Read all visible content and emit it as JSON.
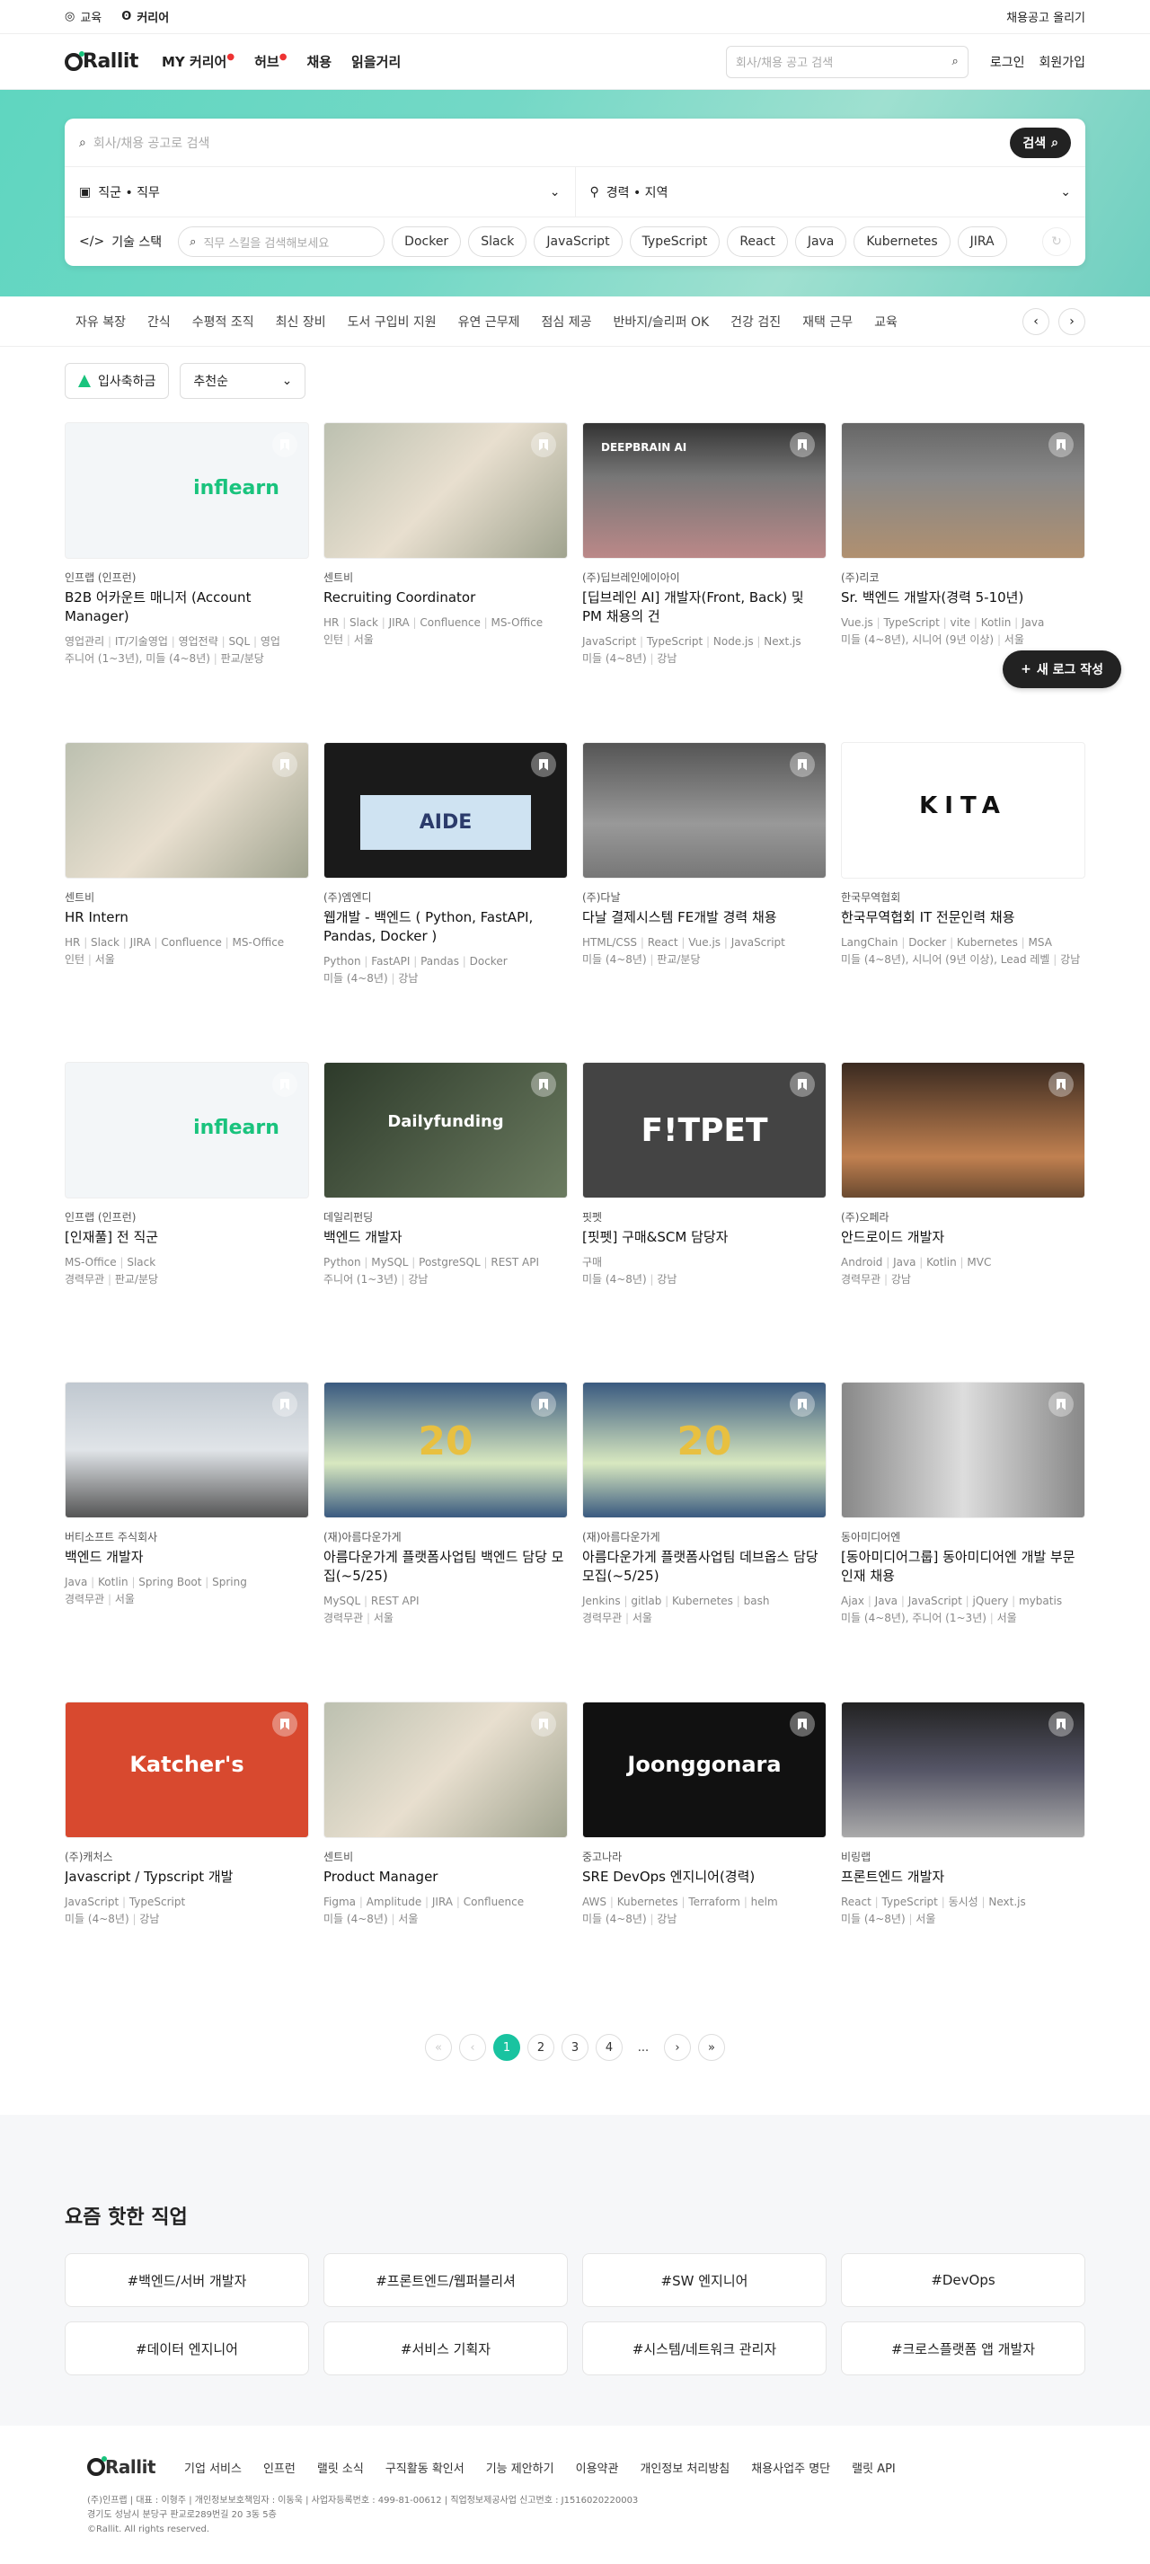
{
  "topbar": {
    "items": [
      "교육",
      "커리어"
    ],
    "post_job": "채용공고 올리기"
  },
  "header": {
    "logo": "Rallit",
    "nav": [
      "MY 커리어",
      "허브",
      "채용",
      "읽을거리"
    ],
    "search_placeholder": "회사/채용 공고 검색",
    "login": "로그인",
    "signup": "회원가입"
  },
  "hero": {
    "search_placeholder": "회사/채용 공고로 검색",
    "search_button": "검색",
    "job_select": "직군 • 직무",
    "loc_select": "경력 • 지역",
    "skill_label": "기술 스택",
    "skill_placeholder": "직무 스킬을 검색해보세요",
    "chips": [
      "Docker",
      "Slack",
      "JavaScript",
      "TypeScript",
      "React",
      "Java",
      "Kubernetes",
      "JIRA"
    ]
  },
  "tags": [
    "자유 복장",
    "간식",
    "수평적 조직",
    "최신 장비",
    "도서 구입비 지원",
    "유연 근무제",
    "점심 제공",
    "반바지/슬리퍼 OK",
    "건강 검진",
    "재택 근무",
    "교육"
  ],
  "filters": {
    "bonus": "입사축하금",
    "sort": "추천순"
  },
  "new_log": "새 로그 작성",
  "cards": [
    {
      "company": "인프랩 (인프런)",
      "title": "B2B 어카운트 매니저 (Account Manager)",
      "skills": [
        "영업관리",
        "IT/기술영업",
        "영업전략",
        "SQL",
        "영업"
      ],
      "info": [
        "주니어 (1~3년), 미들 (4~8년)",
        "판교/분당"
      ],
      "thumb": "inflearn",
      "logo_text": "inflearn"
    },
    {
      "company": "센트비",
      "title": "Recruiting Coordinator",
      "skills": [
        "HR",
        "Slack",
        "JIRA",
        "Confluence",
        "MS-Office"
      ],
      "info": [
        "인턴",
        "서울"
      ],
      "thumb": "phone",
      "logo_text": ""
    },
    {
      "company": "(주)딥브레인에이아이",
      "title": "[딥브레인 AI] 개발자(Front, Back) 및 PM 채용의 건",
      "skills": [
        "JavaScript",
        "TypeScript",
        "Node.js",
        "Next.js"
      ],
      "info": [
        "미들 (4~8년)",
        "강남"
      ],
      "thumb": "office",
      "logo_text": "DEEPBRAIN AI"
    },
    {
      "company": "(주)리코",
      "title": "Sr. 백엔드 개발자(경력 5-10년)",
      "skills": [
        "Vue.js",
        "TypeScript",
        "vite",
        "Kotlin",
        "Java"
      ],
      "info": [
        "미들 (4~8년), 시니어 (9년 이상)",
        "서울"
      ],
      "thumb": "crowd",
      "logo_text": ""
    },
    {
      "company": "센트비",
      "title": "HR Intern",
      "skills": [
        "HR",
        "Slack",
        "JIRA",
        "Confluence",
        "MS-Office"
      ],
      "info": [
        "인턴",
        "서울"
      ],
      "thumb": "phone",
      "logo_text": ""
    },
    {
      "company": "(주)엠엔디",
      "title": "웹개발 - 백엔드 ( Python, FastAPI, Pandas, Docker )",
      "skills": [
        "Python",
        "FastAPI",
        "Pandas",
        "Docker"
      ],
      "info": [
        "미들 (4~8년)",
        "강남"
      ],
      "thumb": "aide",
      "logo_text": "AIDE"
    },
    {
      "company": "(주)다날",
      "title": "다날 결제시스템 FE개발 경력 채용",
      "skills": [
        "HTML/CSS",
        "React",
        "Vue.js",
        "JavaScript"
      ],
      "info": [
        "미들 (4~8년)",
        "판교/분당"
      ],
      "thumb": "hall",
      "logo_text": ""
    },
    {
      "company": "한국무역협회",
      "title": "한국무역협회 IT 전문인력 채용",
      "skills": [
        "LangChain",
        "Docker",
        "Kubernetes",
        "MSA"
      ],
      "info": [
        "미들 (4~8년), 시니어 (9년 이상), Lead 레벨",
        "강남"
      ],
      "thumb": "kita",
      "logo_text": "KITA"
    },
    {
      "company": "인프랩 (인프런)",
      "title": "[인재풀] 전 직군",
      "skills": [
        "MS-Office",
        "Slack"
      ],
      "info": [
        "경력무관",
        "판교/분당"
      ],
      "thumb": "inflearn",
      "logo_text": "inflearn"
    },
    {
      "company": "데일리펀딩",
      "title": "백엔드 개발자",
      "skills": [
        "Python",
        "MySQL",
        "PostgreSQL",
        "REST API"
      ],
      "info": [
        "주니어 (1~3년)",
        "강남"
      ],
      "thumb": "daily",
      "logo_text": "Dailyfunding"
    },
    {
      "company": "핏펫",
      "title": "[핏펫] 구매&SCM 담당자",
      "skills": [
        "구매"
      ],
      "info": [
        "미들 (4~8년)",
        "강남"
      ],
      "thumb": "fitpet",
      "logo_text": "F!TPET"
    },
    {
      "company": "(주)오페라",
      "title": "안드로이드 개발자",
      "skills": [
        "Android",
        "Java",
        "Kotlin",
        "MVC"
      ],
      "info": [
        "경력무관",
        "강남"
      ],
      "thumb": "bar",
      "logo_text": ""
    },
    {
      "company": "버티소프트 주식회사",
      "title": "백엔드 개발자",
      "skills": [
        "Java",
        "Kotlin",
        "Spring Boot",
        "Spring"
      ],
      "info": [
        "경력무관",
        "서울"
      ],
      "thumb": "city",
      "logo_text": ""
    },
    {
      "company": "(재)아름다운가게",
      "title": "아름다운가게 플랫폼사업팀 백엔드 담당 모집(~5/25)",
      "skills": [
        "MySQL",
        "REST API"
      ],
      "info": [
        "경력무관",
        "서울"
      ],
      "thumb": "banner",
      "logo_text": "20"
    },
    {
      "company": "(재)아름다운가게",
      "title": "아름다운가게 플랫폼사업팀 데브옵스 담당 모집(~5/25)",
      "skills": [
        "Jenkins",
        "gitlab",
        "Kubernetes",
        "bash"
      ],
      "info": [
        "경력무관",
        "서울"
      ],
      "thumb": "banner",
      "logo_text": "20"
    },
    {
      "company": "동아미디어엔",
      "title": "[동아미디어그룹] 동아미디어엔 개발 부문 인재 채용",
      "skills": [
        "Ajax",
        "Java",
        "JavaScript",
        "jQuery",
        "mybatis"
      ],
      "info": [
        "미들 (4~8년), 주니어 (1~3년)",
        "서울"
      ],
      "thumb": "corr",
      "logo_text": ""
    },
    {
      "company": "(주)캐처스",
      "title": "Javascript / Typscript 개발",
      "skills": [
        "JavaScript",
        "TypeScript"
      ],
      "info": [
        "미들 (4~8년)",
        "강남"
      ],
      "thumb": "katch",
      "logo_text": "Katcher's"
    },
    {
      "company": "센트비",
      "title": "Product Manager",
      "skills": [
        "Figma",
        "Amplitude",
        "JIRA",
        "Confluence"
      ],
      "info": [
        "미들 (4~8년)",
        "서울"
      ],
      "thumb": "phone",
      "logo_text": ""
    },
    {
      "company": "중고나라",
      "title": "SRE DevOps 엔지니어(경력)",
      "skills": [
        "AWS",
        "Kubernetes",
        "Terraform",
        "helm"
      ],
      "info": [
        "미들 (4~8년)",
        "강남"
      ],
      "thumb": "joong",
      "logo_text": "Joonggonara"
    },
    {
      "company": "비링랩",
      "title": "프론트엔드 개발자",
      "skills": [
        "React",
        "TypeScript",
        "동시성",
        "Next.js"
      ],
      "info": [
        "미들 (4~8년)",
        "서울"
      ],
      "thumb": "team",
      "logo_text": ""
    }
  ],
  "pager": {
    "pages": [
      "1",
      "2",
      "3",
      "4"
    ],
    "ellipsis": "...",
    "current": "1"
  },
  "hot": {
    "title": "요즘 핫한 직업",
    "items": [
      "#백엔드/서버 개발자",
      "#프론트엔드/웹퍼블리셔",
      "#SW 엔지니어",
      "#DevOps",
      "#데이터 엔지니어",
      "#서비스 기획자",
      "#시스템/네트워크 관리자",
      "#크로스플랫폼 앱 개발자"
    ]
  },
  "footer": {
    "logo": "Rallit",
    "links": [
      "기업 서비스",
      "인프런",
      "랠릿 소식",
      "구직활동 확인서",
      "기능 제안하기",
      "이용약관",
      "개인정보 처리방침",
      "채용사업주 명단",
      "랠릿 API"
    ],
    "line1": "(주)인프랩 | 대표 : 이형주 | 개인정보보호책임자 : 이동욱 | 사업자등록번호 : 499-81-00612 | 직업정보제공사업 신고번호 : J1516020220003",
    "line2": "경기도 성남시 분당구 판교로289번길 20 3동 5층",
    "line3": "©Rallit. All rights reserved."
  },
  "colors": {
    "accent": "#19c3a0",
    "dark": "#222222"
  }
}
